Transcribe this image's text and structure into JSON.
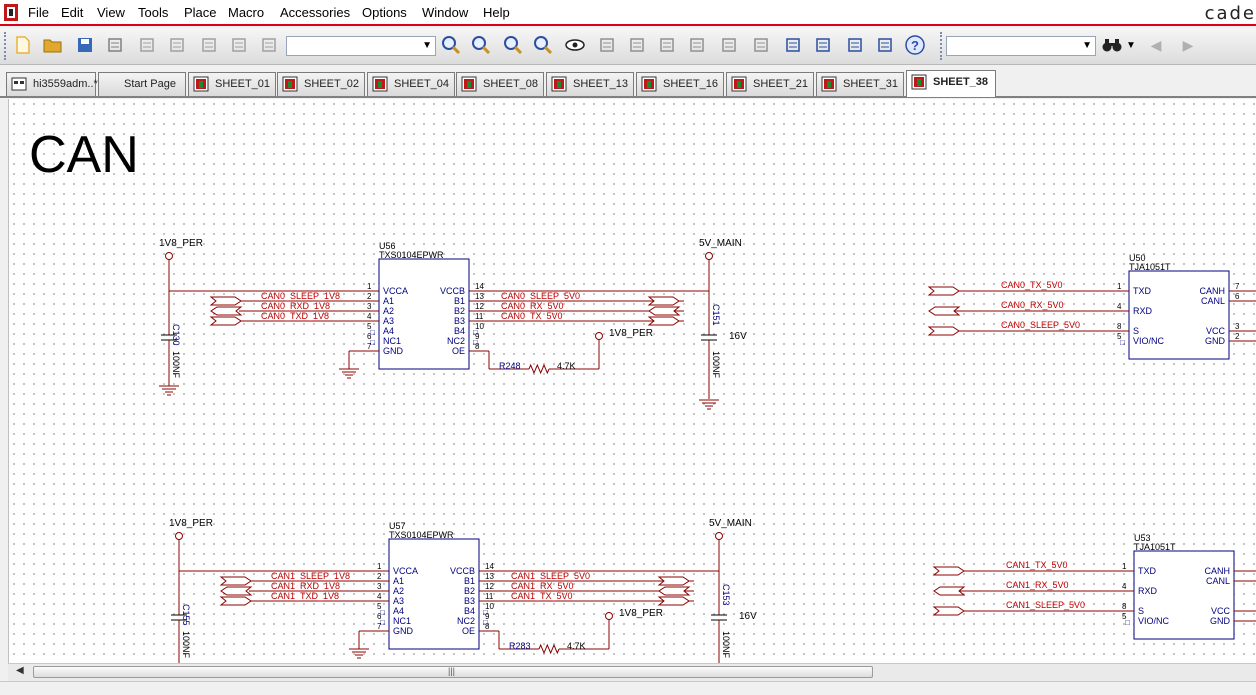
{
  "menubar": {
    "items": [
      "File",
      "Edit",
      "View",
      "Tools",
      "Place",
      "Macro",
      "Accessories",
      "Options",
      "Window",
      "Help"
    ],
    "brand": "cade"
  },
  "toolbar": {
    "icons": [
      "new-icon",
      "open-icon",
      "save-icon",
      "print-icon",
      "cut-icon",
      "copy-icon",
      "paste-icon",
      "undo-icon",
      "redo-icon",
      "zoom-in-icon",
      "zoom-out-icon",
      "zoom-area-icon",
      "zoom-all-icon",
      "eye-icon",
      "annotate-icon",
      "netlist-icon",
      "drc-icon",
      "bom-icon",
      "cross-ref-icon",
      "report-icon",
      "project-icon",
      "library-icon",
      "part-icon",
      "hierarchy-icon",
      "help-icon"
    ],
    "search_icon": "binoculars-icon"
  },
  "tabs": [
    {
      "label": "hi3559adm..*",
      "active": false
    },
    {
      "label": "Start Page",
      "active": false
    },
    {
      "label": "SHEET_01",
      "active": false
    },
    {
      "label": "SHEET_02",
      "active": false
    },
    {
      "label": "SHEET_04",
      "active": false
    },
    {
      "label": "SHEET_08",
      "active": false
    },
    {
      "label": "SHEET_13",
      "active": false
    },
    {
      "label": "SHEET_16",
      "active": false
    },
    {
      "label": "SHEET_21",
      "active": false
    },
    {
      "label": "SHEET_31",
      "active": false
    },
    {
      "label": "SHEET_38",
      "active": true
    }
  ],
  "schematic": {
    "title": "CAN",
    "block0": {
      "pwr_left": "1V8_PER",
      "pwr_right": "5V_MAIN",
      "pwr_oe": "1V8_PER",
      "ic_ref": "U56",
      "ic_part": "TXS0104EPWR",
      "cap_left_ref": "C130",
      "cap_left_val": "100NF",
      "cap_right_ref": "C151",
      "cap_right_val": "100NF",
      "cap_right_volt": "16V",
      "res_ref": "R248",
      "res_val": "4.7K",
      "left_nets": [
        "CAN0_SLEEP_1V8",
        "CAN0_RXD_1V8",
        "CAN0_TXD_1V8"
      ],
      "right_nets": [
        "CAN0_SLEEP_5V0",
        "CAN0_RX_5V0",
        "CAN0_TX_5V0"
      ],
      "left_pins": [
        "VCCA",
        "A1",
        "A2",
        "A3",
        "A4",
        "NC1",
        "GND"
      ],
      "left_pin_nums": [
        "1",
        "2",
        "3",
        "4",
        "5",
        "6",
        "7"
      ],
      "right_pins": [
        "VCCB",
        "B1",
        "B2",
        "B3",
        "B4",
        "NC2",
        "OE"
      ],
      "right_pin_nums": [
        "14",
        "13",
        "12",
        "11",
        "10",
        "9",
        "8"
      ],
      "tja_ref": "U50",
      "tja_part": "TJA1051T",
      "tja_nets": [
        "CAN0_TX_5V0",
        "CAN0_RX_5V0",
        "CAN0_SLEEP_5V0"
      ],
      "tja_left_pins": [
        "TXD",
        "RXD",
        "S",
        "VIO/NC"
      ],
      "tja_left_nums": [
        "1",
        "4",
        "8",
        "5"
      ],
      "tja_right_pins": [
        "CANH",
        "CANL",
        "VCC",
        "GND"
      ],
      "tja_right_nums": [
        "7",
        "6",
        "3",
        "2"
      ]
    },
    "block1": {
      "pwr_left": "1V8_PER",
      "pwr_right": "5V_MAIN",
      "pwr_oe": "1V8_PER",
      "ic_ref": "U57",
      "ic_part": "TXS0104EPWR",
      "cap_left_ref": "C155",
      "cap_left_val": "100NF",
      "cap_right_ref": "C153",
      "cap_right_val": "100NF",
      "cap_right_volt": "16V",
      "res_ref": "R283",
      "res_val": "4.7K",
      "left_nets": [
        "CAN1_SLEEP_1V8",
        "CAN1_RXD_1V8",
        "CAN1_TXD_1V8"
      ],
      "right_nets": [
        "CAN1_SLEEP_5V0",
        "CAN1_RX_5V0",
        "CAN1_TX_5V0"
      ],
      "left_pins": [
        "VCCA",
        "A1",
        "A2",
        "A3",
        "A4",
        "NC1",
        "GND"
      ],
      "left_pin_nums": [
        "1",
        "2",
        "3",
        "4",
        "5",
        "6",
        "7"
      ],
      "right_pins": [
        "VCCB",
        "B1",
        "B2",
        "B3",
        "B4",
        "NC2",
        "OE"
      ],
      "right_pin_nums": [
        "14",
        "13",
        "12",
        "11",
        "10",
        "9",
        "8"
      ],
      "tja_ref": "U53",
      "tja_part": "TJA1051T",
      "tja_nets": [
        "CAN1_TX_5V0",
        "CAN1_RX_5V0",
        "CAN1_SLEEP_5V0"
      ],
      "tja_left_pins": [
        "TXD",
        "RXD",
        "S",
        "VIO/NC"
      ],
      "tja_left_nums": [
        "1",
        "4",
        "8",
        "5"
      ],
      "tja_right_pins": [
        "CANH",
        "CANL",
        "VCC",
        "GND"
      ],
      "tja_right_nums": [
        "",
        "",
        "",
        ""
      ]
    }
  },
  "scrollbar": {
    "left_arrow": "◀",
    "grip": "|||"
  },
  "colors": {
    "wire": "#8b0000",
    "net": "#c00000",
    "part": "#000080",
    "menu_accent": "#d8001c"
  }
}
